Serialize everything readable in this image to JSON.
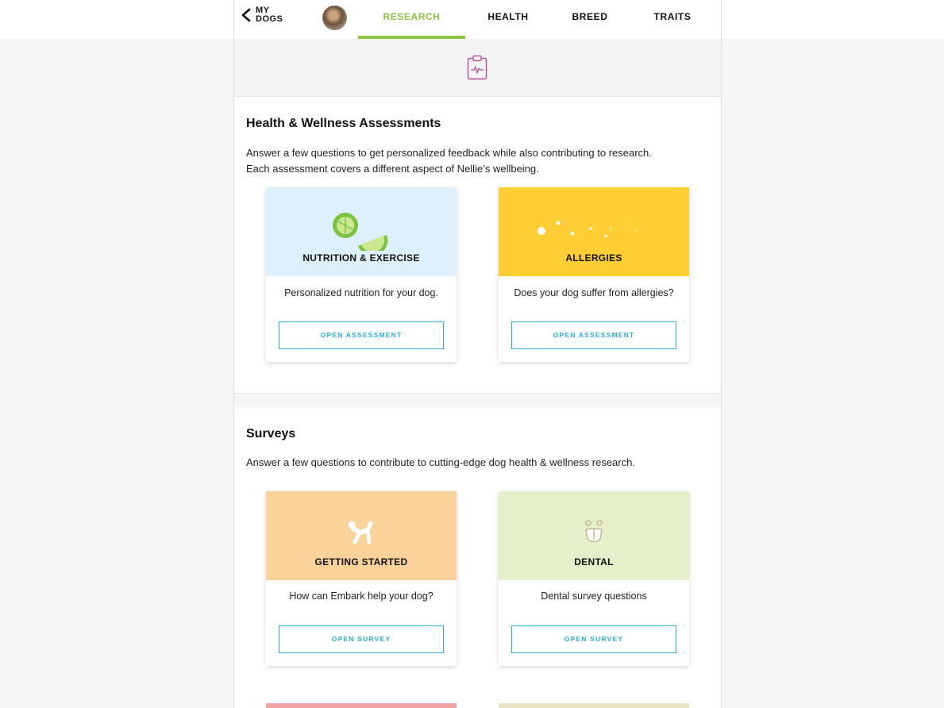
{
  "nav": {
    "back_label": "MY DOGS",
    "tabs": [
      {
        "label": "RESEARCH",
        "active": true
      },
      {
        "label": "HEALTH",
        "active": false
      },
      {
        "label": "BREED",
        "active": false
      },
      {
        "label": "TRAITS",
        "active": false
      }
    ],
    "active_color": "#8cc63f"
  },
  "header": {
    "icon": "clipboard-heartbeat-icon"
  },
  "assessments": {
    "title": "Health & Wellness Assessments",
    "description_line1": "Answer a few questions to get personalized feedback while also contributing to research.",
    "description_line2": "Each assessment covers a different aspect of Nellie’s wellbeing.",
    "cards": [
      {
        "title": "NUTRITION & EXERCISE",
        "text": "Personalized nutrition for your dog.",
        "button": "OPEN ASSESSMENT",
        "color": "#ddf0fb",
        "icon": "lime-slices-icon"
      },
      {
        "title": "ALLERGIES",
        "text": "Does your dog suffer from allergies?",
        "button": "OPEN ASSESSMENT",
        "color": "#ffcd34",
        "icon": "pollen-dots-icon"
      }
    ]
  },
  "surveys": {
    "title": "Surveys",
    "description": "Answer a few questions to contribute to cutting-edge dog health & wellness research.",
    "cards": [
      {
        "title": "GETTING STARTED",
        "text": "How can Embark help your dog?",
        "button": "OPEN SURVEY",
        "color": "#fad29a",
        "icon": "balloon-dog-icon"
      },
      {
        "title": "DENTAL",
        "text": "Dental survey questions",
        "button": "OPEN SURVEY",
        "color": "#e3f0c9",
        "icon": "dog-teeth-icon"
      }
    ]
  },
  "next_cards": [
    {
      "color": "#f3a4a4"
    },
    {
      "color": "#e9e4c6"
    }
  ]
}
